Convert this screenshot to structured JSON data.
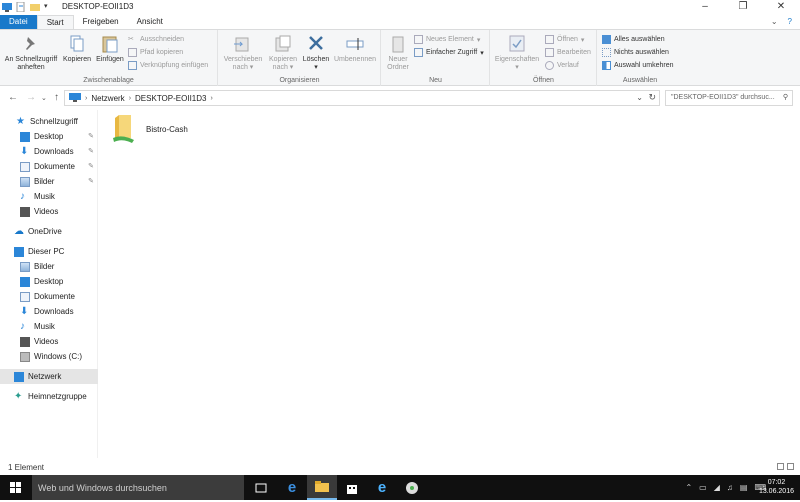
{
  "window": {
    "title": "DESKTOP-EOII1D3"
  },
  "tabs": {
    "file": "Datei",
    "start": "Start",
    "share": "Freigeben",
    "view": "Ansicht"
  },
  "ribbon": {
    "clipboard": {
      "label": "Zwischenablage",
      "pin": "An Schnellzugriff anheften",
      "copy": "Kopieren",
      "paste": "Einfügen",
      "cut": "Ausschneiden",
      "copy_path": "Pfad kopieren",
      "paste_shortcut": "Verknüpfung einfügen"
    },
    "organize": {
      "label": "Organisieren",
      "move_to": "Verschieben nach",
      "copy_to": "Kopieren nach",
      "delete": "Löschen",
      "rename": "Umbenennen"
    },
    "new": {
      "label": "Neu",
      "new_folder": "Neuer Ordner",
      "new_item": "Neues Element",
      "easy_access": "Einfacher Zugriff"
    },
    "open": {
      "label": "Öffnen",
      "properties": "Eigenschaften",
      "open": "Öffnen",
      "edit": "Bearbeiten",
      "history": "Verlauf"
    },
    "select": {
      "label": "Auswählen",
      "select_all": "Alles auswählen",
      "select_none": "Nichts auswählen",
      "invert": "Auswahl umkehren"
    }
  },
  "address": {
    "crumbs": [
      "Netzwerk",
      "DESKTOP-EOII1D3"
    ],
    "search_placeholder": "\"DESKTOP-EOII1D3\" durchsuc..."
  },
  "sidebar": {
    "quick_access": "Schnellzugriff",
    "quick_items": [
      "Desktop",
      "Downloads",
      "Dokumente",
      "Bilder",
      "Musik",
      "Videos"
    ],
    "onedrive": "OneDrive",
    "this_pc": "Dieser PC",
    "pc_items": [
      "Bilder",
      "Desktop",
      "Dokumente",
      "Downloads",
      "Musik",
      "Videos",
      "Windows (C:)"
    ],
    "network": "Netzwerk",
    "homegroup": "Heimnetzgruppe"
  },
  "content": {
    "items": [
      "Bistro-Cash"
    ]
  },
  "status": {
    "count": "1 Element"
  },
  "taskbar": {
    "search_placeholder": "Web und Windows durchsuchen",
    "time": "07:02",
    "date": "13.06.2016"
  },
  "colors": {
    "accent": "#1979ca",
    "selected": "#cce8ff",
    "taskbar": "#101010"
  }
}
